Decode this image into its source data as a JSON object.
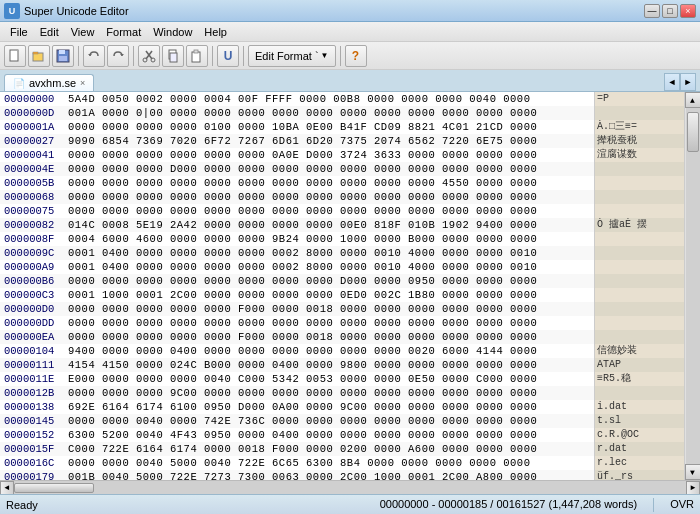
{
  "window": {
    "title": "Super Unicode Editor",
    "icon": "U"
  },
  "title_controls": {
    "minimize": "—",
    "maximize": "□",
    "close": "×"
  },
  "menu": {
    "items": [
      "File",
      "Edit",
      "View",
      "Format",
      "Window",
      "Help"
    ]
  },
  "toolbar": {
    "edit_format_label": "Edit Format `",
    "buttons": [
      "new",
      "open",
      "save",
      "undo",
      "redo",
      "cut",
      "copy",
      "paste",
      "special",
      "help"
    ]
  },
  "tab": {
    "name": "avxhm.se",
    "close": "×"
  },
  "hex_data": {
    "lines": [
      {
        "addr": "00000000",
        "bytes": "5A4D 0050  0002 0000  0004 00F   FFFF 0000  00B8 0000  0000 0000  0040 0000"
      },
      {
        "addr": "0000000D",
        "bytes": "001A 0000  0|00 0000  0000 0000  0000 0000  0000 0000  0000 0000  0000 0000"
      },
      {
        "addr": "0000001A",
        "bytes": "0000 0000  0000 0000  0100 0000  10BA 0E00  B41F CD09 8821 4C01 21CD 0000"
      },
      {
        "addr": "00000027",
        "bytes": "9090 6854  7369 7020  6F72 7267  6D61 6D20  7375 2074  6562 7220  6E75 0000"
      },
      {
        "addr": "00000041",
        "bytes": "0000 0000  0000 0000  0000 0000  0A0E D000  3724 3633  0000 0000  0000 0000"
      },
      {
        "addr": "0000004E",
        "bytes": "0000 0000  0000 D000  0000 0000  0000 0000  0000 0000  0000 0000  0000 0000"
      },
      {
        "addr": "0000005B",
        "bytes": "0000 0000  0000 0000  0000 0000  0000 0000  0000 0000  0000 4550  0000 0000"
      },
      {
        "addr": "00000068",
        "bytes": "0000 0000  0000 0000  0000 0000  0000 0000  0000 0000  0000 0000  0000 0000"
      },
      {
        "addr": "00000075",
        "bytes": "0000 0000  0000 0000  0000 0000  0000 0000  0000 0000  0000 0000  0000 0000"
      },
      {
        "addr": "00000082",
        "bytes": "014C 0008  5E19 2A42  0000 0000  0000 0000  00E0 818F  010B 1902 9400 0000"
      },
      {
        "addr": "0000008F",
        "bytes": "0004 6000  4600 0000  0000 0000  9B24 0000  1000 0000  B000 0000  0000 0000"
      },
      {
        "addr": "0000009C",
        "bytes": "0001 0400  0000 0000  0000 0000  0002 8000  0000 0010  4000 0000  0000 0010"
      },
      {
        "addr": "000000A9",
        "bytes": "0001 0400  0000 0000  0000 0000  0002 8000  0000 0010  4000 0000  0000 0010"
      },
      {
        "addr": "000000B6",
        "bytes": "0000 0000  0000 0000  0000 0000  0000 0000  D000 0000  0950 0000  0000 0000"
      },
      {
        "addr": "000000C3",
        "bytes": "0001 1000  0001 2C00  0000 0000  0000 0000  0ED0 002C  1B80 0000  0000 0000"
      },
      {
        "addr": "000000D0",
        "bytes": "0000 0000  0000 0000  0000 F000  0000 0018  0000 0000  0000 0000  0000 0000"
      },
      {
        "addr": "000000DD",
        "bytes": "0000 0000  0000 0000  0000 0000  0000 0000  0000 0000  0000 0000  0000 0000"
      },
      {
        "addr": "000000EA",
        "bytes": "0000 0000  0000 0000  0000 F000  0000 0018  0000 0000  0000 0000  0000 0000"
      },
      {
        "addr": "00000104",
        "bytes": "9400 0000  0000 0400  0000 0000  0000 0000  0000 0000  0020 6000  4144 0000"
      },
      {
        "addr": "00000111",
        "bytes": "4154 4150  0000 024C  B000 0000  0400 0000  9800 0000  0000 0000  0000 0000"
      },
      {
        "addr": "0000011E",
        "bytes": "E000 0000  0000 0000  0040 C000  5342 0053  0000 0000  0E50 0000  C000 0000"
      },
      {
        "addr": "0000012B",
        "bytes": "0000 0000  0000 9C00  0000 0000  0000 0000  0000 0000  0000 0000  0000 0000"
      },
      {
        "addr": "00000138",
        "bytes": "692E 6164  6174 6100  0950 D000  0A00 0000  9C00 0000  0000 0000  0000 0000"
      },
      {
        "addr": "00000145",
        "bytes": "0000 0000  0040 0000  742E 736C  0000 0000  0000 0000  0000 0000  0000 0000"
      },
      {
        "addr": "00000152",
        "bytes": "6300 5200  0040 4F43  0950 0000  0400 0000  0000 0000  0000 0000  0000 0000"
      },
      {
        "addr": "0000015F",
        "bytes": "C000 722E  6164 6174  0000 0018  F000 0000  0200 0000  A600 0000  0000 0000"
      },
      {
        "addr": "0000016C",
        "bytes": "0000 0000  0040 5000  0040 722E  6C65 6300  8B4  0000  0000 0000  0000 0000"
      },
      {
        "addr": "00000179",
        "bytes": "001B 0040  5000 722E  7273 7300  0063 0000  2C00 1000  0001 2C00  A800 0000"
      }
    ]
  },
  "char_data": {
    "lines": [
      "=P",
      "",
      "À.□三≡=",
      "撵税蚕税",
      "渲腐谋数",
      "",
      "",
      "",
      "",
      "Ò 攎aÈ 摆",
      "",
      "",
      "",
      "",
      "",
      "",
      "",
      "",
      "信德妙装",
      "ATAP",
      "≡R5.稳",
      "",
      "i.dat",
      "t.sl",
      "c.R.@OC",
      "r.dat",
      "r.lec",
      "üf._rs"
    ]
  },
  "status": {
    "ready": "Ready",
    "position": "00000000 - 00000185 / 00161527 (1,447,208 words)",
    "mode": "OVR"
  },
  "scrollbar": {
    "up_arrow": "▲",
    "down_arrow": "▼",
    "left_arrow": "◄",
    "right_arrow": "►"
  }
}
